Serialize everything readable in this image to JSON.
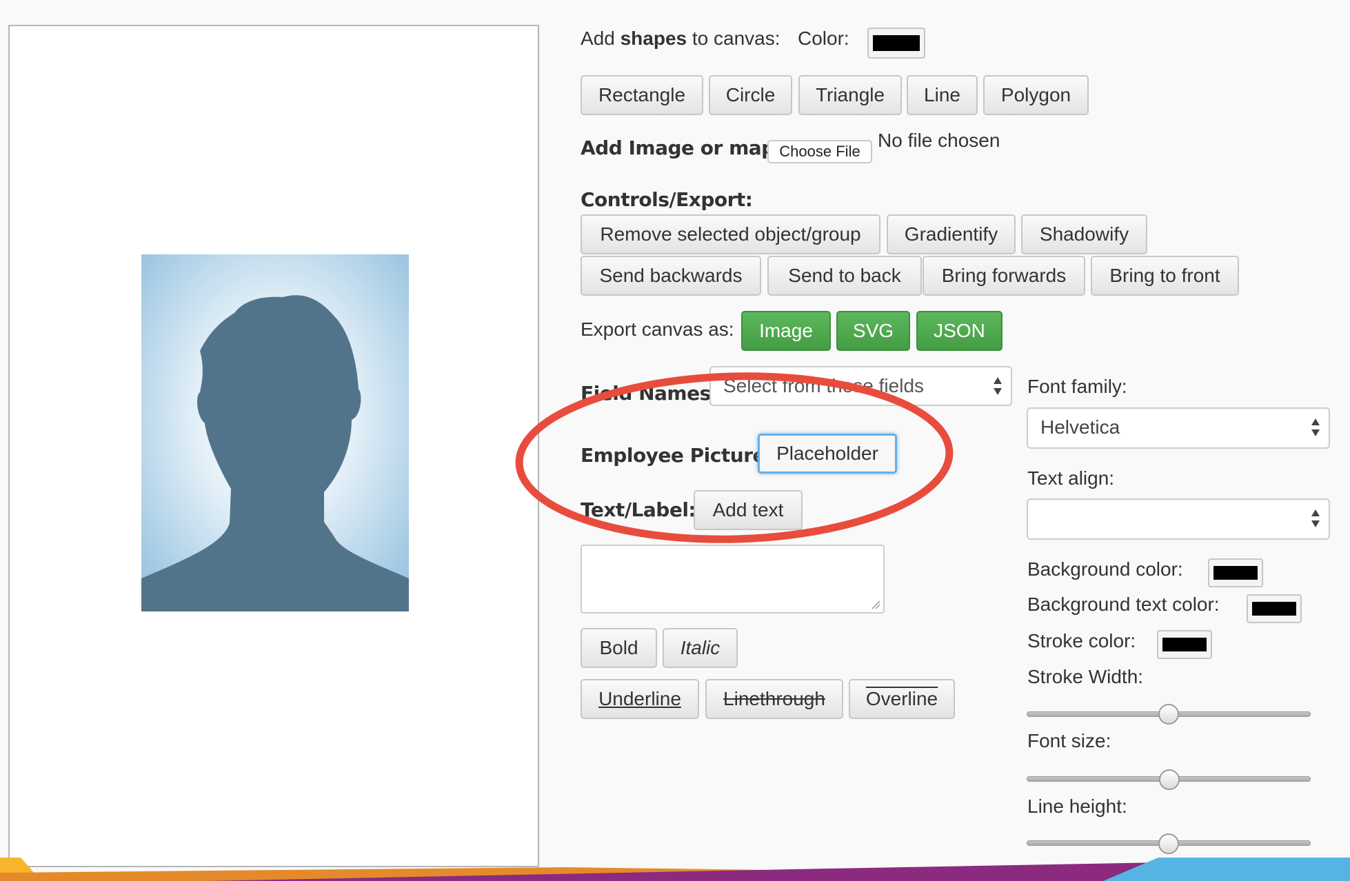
{
  "shapes": {
    "label_prefix": "Add ",
    "label_bold": "shapes",
    "label_suffix": " to canvas:",
    "color_label": "Color:",
    "color_value": "#000000",
    "buttons": [
      "Rectangle",
      "Circle",
      "Triangle",
      "Line",
      "Polygon"
    ]
  },
  "image": {
    "label": "Add Image or map:",
    "choose_file": "Choose File",
    "no_file": "No file chosen"
  },
  "controls": {
    "label": "Controls/Export:",
    "row1": [
      "Remove selected object/group",
      "Gradientify",
      "Shadowify"
    ],
    "row2": [
      "Send backwards",
      "Send to back",
      "Bring forwards",
      "Bring to front"
    ]
  },
  "export": {
    "label": "Export canvas as:",
    "buttons": [
      "Image",
      "SVG",
      "JSON"
    ]
  },
  "fields": {
    "label": "Field Names:",
    "placeholder": "Select from these fields"
  },
  "employee": {
    "label": "Employee Picture:",
    "button": "Placeholder"
  },
  "text": {
    "label": "Text/Label:",
    "add_button": "Add text",
    "bold": "Bold",
    "italic": "Italic",
    "underline": "Underline",
    "linethrough": "Linethrough",
    "overline": "Overline"
  },
  "right": {
    "font_family_label": "Font family:",
    "font_family_value": "Helvetica",
    "text_align_label": "Text align:",
    "text_align_value": "",
    "bg_color_label": "Background color:",
    "bg_text_color_label": "Background text color:",
    "stroke_color_label": "Stroke color:",
    "stroke_width_label": "Stroke Width:",
    "font_size_label": "Font size:",
    "line_height_label": "Line height:",
    "colors": {
      "bg": "#000000",
      "bg_text": "#000000",
      "stroke": "#000000"
    },
    "sliders": {
      "stroke_width": 0.5,
      "font_size": 0.5,
      "line_height": 0.5
    }
  },
  "accent": {
    "highlight": "#e74c3c",
    "green": "#5cb85c"
  }
}
